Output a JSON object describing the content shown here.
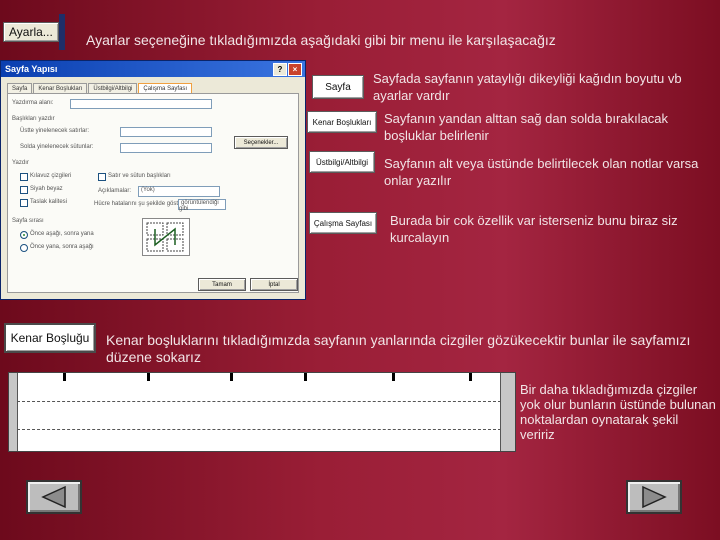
{
  "top": {
    "ayarla_button": "Ayarla...",
    "intro_text": "Ayarlar seçeneğine tıkladığımızda aşağıdaki gibi bir menu ile karşılaşacağız"
  },
  "dialog": {
    "title": "Sayfa Yapısı",
    "tabs": [
      "Sayfa",
      "Kenar Boşlukları",
      "Üstbilgi/Altbilgi",
      "Çalışma Sayfası"
    ],
    "print_area_label": "Yazdırma alanı:",
    "print_titles_label": "Başlıkları yazdır",
    "rows_repeat_label": "Üstte yinelenecek satırlar:",
    "cols_repeat_label": "Solda yinelenecek sütunlar:",
    "print_label": "Yazdır",
    "grid_label": "Kılavuz çizgileri",
    "bw_label": "Siyah beyaz",
    "draft_label": "Taslak kalitesi",
    "rowcol_label": "Satır ve sütun başlıkları",
    "comments_label": "Açıklamalar:",
    "comments_value": "(Yok)",
    "errors_label": "Hücre hatalarını şu şekilde göster:",
    "errors_value": "görüntülendiği gibi",
    "page_order_label": "Sayfa sırası",
    "down_then_over": "Önce aşağı, sonra yana",
    "over_then_down": "Önce yana, sonra aşağı",
    "options_button": "Seçenekler...",
    "ok_button": "Tamam",
    "cancel_button": "İptal",
    "help_glyph": "?",
    "close_glyph": "×"
  },
  "items": [
    {
      "button": "Sayfa",
      "desc": "Sayfada sayfanın yataylığı dikeyliği kağıdın boyutu vb ayarlar vardır"
    },
    {
      "button": "Kenar Boşlukları",
      "desc": "Sayfanın yandan alttan sağ dan solda bırakılacak boşluklar belirlenir"
    },
    {
      "button": "Üstbilgi/Altbilgi",
      "desc": "Sayfanın alt veya üstünde belirtilecek olan notlar varsa onlar yazılır"
    },
    {
      "button": "Çalışma Sayfası",
      "desc": "Burada bir cok özellik var isterseniz bunu biraz siz kurcalayın"
    }
  ],
  "kenar": {
    "button": "Kenar Boşluğu",
    "desc": "Kenar boşluklarını tıkladığımızda sayfanın yanlarında cizgiler gözükecektir bunlar ile sayfamızı düzene sokarız",
    "side_note": "Bir daha tıkladığımızda çizgiler yok olur bunların üstünde bulunan noktalardan oynatarak şekil veririz"
  },
  "nav": {
    "prev_icon": "triangle-left-icon",
    "next_icon": "triangle-right-icon"
  }
}
